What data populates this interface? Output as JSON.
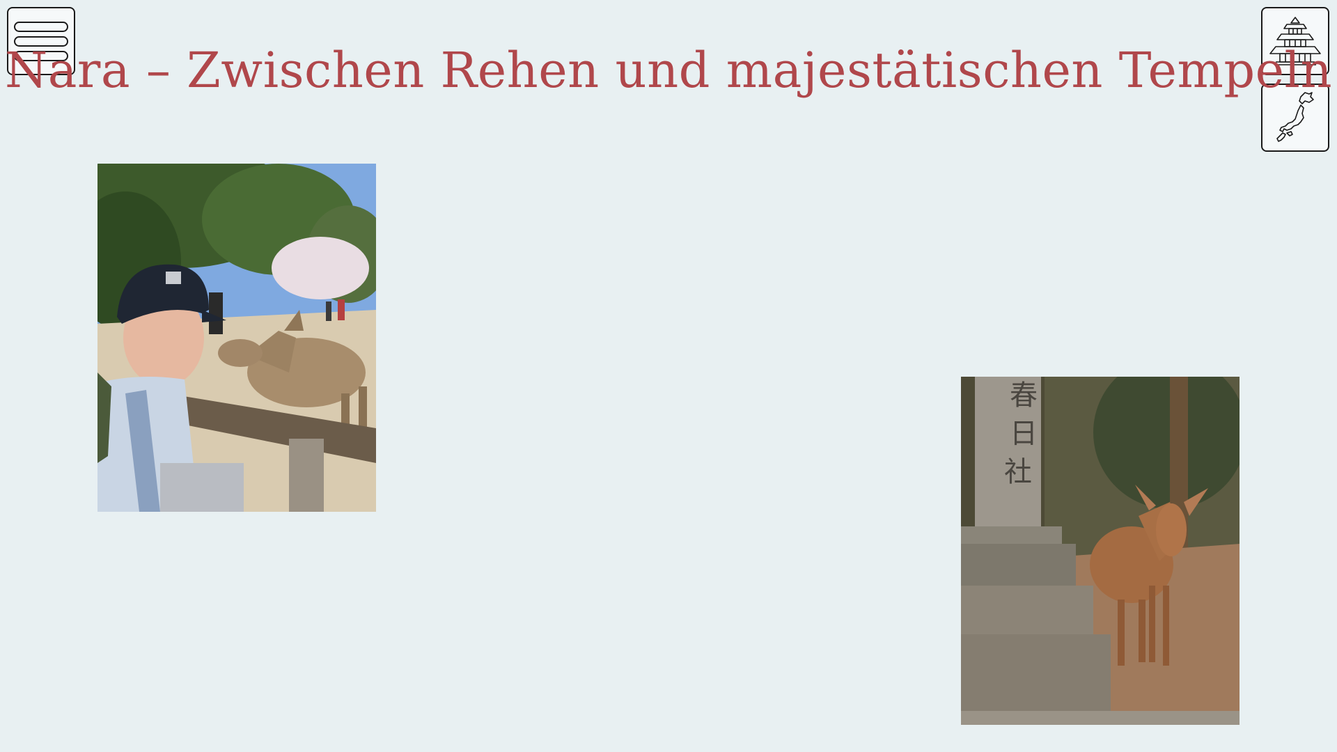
{
  "page": {
    "title": "Nara – Zwischen Rehen und majestätischen Tempeln"
  },
  "nav": {
    "menu_icon": "hamburger-menu-icon",
    "castle_icon": "japanese-castle-icon",
    "map_icon": "japan-map-icon"
  },
  "photos": [
    {
      "name": "selfie-with-deer",
      "description_icon": "photo"
    },
    {
      "name": "deer-at-shrine-lantern",
      "description_icon": "photo"
    }
  ],
  "photo_text": {
    "lantern_inscription": "春日社"
  },
  "colors": {
    "background": "#e8f0f2",
    "title": "#b0474b"
  }
}
